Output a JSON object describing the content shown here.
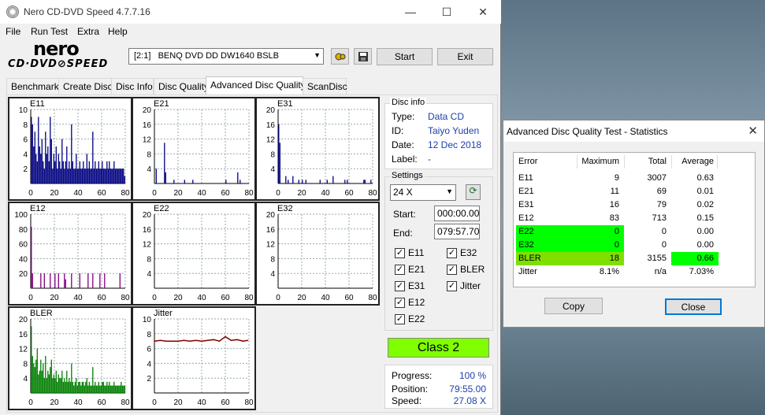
{
  "app": {
    "title": "Nero CD-DVD Speed 4.7.7.16"
  },
  "menu": [
    "File",
    "Run Test",
    "Extra",
    "Help"
  ],
  "logo": {
    "line1": "nero",
    "line2": "CD·DVD⊘SPEED"
  },
  "toolbar": {
    "drive": "[2:1]   BENQ DVD DD DW1640 BSLB",
    "start_label": "Start",
    "exit_label": "Exit"
  },
  "tabs": [
    "Benchmark",
    "Create Disc",
    "Disc Info",
    "Disc Quality",
    "Advanced Disc Quality",
    "ScanDisc"
  ],
  "active_tab": "Advanced Disc Quality",
  "disc_info": {
    "title": "Disc info",
    "type_label": "Type:",
    "type": "Data CD",
    "id_label": "ID:",
    "id": "Taiyo Yuden",
    "date_label": "Date:",
    "date": "12 Dec 2018",
    "label_label": "Label:",
    "label": "-"
  },
  "settings": {
    "title": "Settings",
    "speed": "24 X",
    "start_label": "Start:",
    "start": "000:00.00",
    "end_label": "End:",
    "end": "079:57.70",
    "checks": {
      "e11": "E11",
      "e21": "E21",
      "e31": "E31",
      "e12": "E12",
      "e22": "E22",
      "e32": "E32",
      "bler": "BLER",
      "jitter": "Jitter"
    }
  },
  "class_label": "Class 2",
  "progress": {
    "progress_label": "Progress:",
    "progress": "100 %",
    "position_label": "Position:",
    "position": "79:55.00",
    "speed_label": "Speed:",
    "speed": "27.08 X"
  },
  "stats_dialog": {
    "title": "Advanced Disc Quality Test - Statistics",
    "headers": [
      "Error",
      "Maximum",
      "Total",
      "Average"
    ],
    "rows": [
      [
        "E11",
        "9",
        "3007",
        "0.63"
      ],
      [
        "E21",
        "11",
        "69",
        "0.01"
      ],
      [
        "E31",
        "16",
        "79",
        "0.02"
      ],
      [
        "E12",
        "83",
        "713",
        "0.15"
      ],
      [
        "E22",
        "0",
        "0",
        "0.00"
      ],
      [
        "E32",
        "0",
        "0",
        "0.00"
      ],
      [
        "BLER",
        "18",
        "3155",
        "0.66"
      ],
      [
        "Jitter",
        "8.1%",
        "n/a",
        "7.03%"
      ]
    ],
    "copy_label": "Copy",
    "close_label": "Close"
  },
  "colors": {
    "e11": "#00007f",
    "e21": "#00007f",
    "e31": "#00007f",
    "e12": "#7f007f",
    "bler": "#007f00",
    "jitter": "#7f0000",
    "class_bg": "#80ff00"
  },
  "chart_data": [
    {
      "type": "bar",
      "title": "E11",
      "xlim": [
        0,
        80
      ],
      "ylim": [
        0,
        10
      ],
      "yticks": [
        2,
        4,
        6,
        8,
        10
      ],
      "xticks": [
        0,
        20,
        40,
        60,
        80
      ],
      "x": [
        0,
        1,
        2,
        3,
        4,
        5,
        6,
        7,
        8,
        9,
        10,
        11,
        12,
        13,
        14,
        15,
        16,
        17,
        18,
        19,
        20,
        21,
        22,
        23,
        24,
        25,
        26,
        27,
        28,
        29,
        30,
        31,
        32,
        33,
        34,
        35,
        36,
        37,
        38,
        39,
        40,
        41,
        42,
        43,
        44,
        45,
        46,
        47,
        48,
        49,
        50,
        51,
        52,
        53,
        54,
        55,
        56,
        57,
        58,
        59,
        60,
        61,
        62,
        63,
        64,
        65,
        66,
        67,
        68,
        69,
        70,
        71,
        72,
        73,
        74,
        75,
        76,
        77,
        78,
        79
      ],
      "values": [
        9,
        8,
        5,
        7,
        4,
        3,
        9,
        5,
        4,
        6,
        3,
        2,
        7,
        4,
        5,
        3,
        9,
        6,
        2,
        4,
        3,
        5,
        2,
        4,
        3,
        2,
        6,
        3,
        2,
        3,
        5,
        2,
        3,
        2,
        8,
        3,
        2,
        2,
        4,
        2,
        2,
        3,
        2,
        2,
        3,
        2,
        2,
        4,
        2,
        3,
        2,
        2,
        7,
        2,
        3,
        2,
        2,
        3,
        2,
        2,
        3,
        2,
        2,
        2,
        3,
        2,
        3,
        2,
        2,
        2,
        3,
        2,
        2,
        2,
        2,
        2,
        2,
        2,
        2,
        1
      ]
    },
    {
      "type": "bar",
      "title": "E21",
      "xlim": [
        0,
        80
      ],
      "ylim": [
        0,
        20
      ],
      "yticks": [
        4,
        8,
        12,
        16,
        20
      ],
      "xticks": [
        0,
        20,
        40,
        60,
        80
      ],
      "x": [
        1,
        8,
        9,
        16,
        25,
        32,
        60,
        70,
        72
      ],
      "values": [
        4,
        11,
        3,
        1,
        1,
        1,
        1,
        3,
        1
      ]
    },
    {
      "type": "bar",
      "title": "E31",
      "xlim": [
        0,
        80
      ],
      "ylim": [
        0,
        20
      ],
      "yticks": [
        4,
        8,
        12,
        16,
        20
      ],
      "xticks": [
        0,
        20,
        40,
        60,
        80
      ],
      "x": [
        0,
        1,
        6,
        8,
        12,
        17,
        20,
        23,
        35,
        41,
        46,
        56,
        58,
        72,
        73,
        78
      ],
      "values": [
        16,
        11,
        2,
        1,
        2,
        1,
        1,
        1,
        1,
        1,
        2,
        1,
        1,
        1,
        1,
        1
      ]
    },
    {
      "type": "bar",
      "title": "E12",
      "xlim": [
        0,
        80
      ],
      "ylim": [
        0,
        100
      ],
      "yticks": [
        20,
        40,
        60,
        80,
        100
      ],
      "xticks": [
        0,
        20,
        40,
        60,
        80
      ],
      "x": [
        0,
        1,
        8,
        11,
        16,
        20,
        23,
        28,
        29,
        34,
        41,
        48,
        52,
        58,
        62,
        75
      ],
      "values": [
        83,
        20,
        20,
        20,
        20,
        20,
        20,
        20,
        12,
        20,
        20,
        20,
        20,
        20,
        20,
        20
      ]
    },
    {
      "type": "bar",
      "title": "E22",
      "xlim": [
        0,
        80
      ],
      "ylim": [
        0,
        20
      ],
      "yticks": [
        4,
        8,
        12,
        16,
        20
      ],
      "xticks": [
        0,
        20,
        40,
        60,
        80
      ],
      "x": [],
      "values": []
    },
    {
      "type": "bar",
      "title": "E32",
      "xlim": [
        0,
        80
      ],
      "ylim": [
        0,
        20
      ],
      "yticks": [
        4,
        8,
        12,
        16,
        20
      ],
      "xticks": [
        0,
        20,
        40,
        60,
        80
      ],
      "x": [],
      "values": []
    },
    {
      "type": "bar",
      "title": "BLER",
      "xlim": [
        0,
        80
      ],
      "ylim": [
        0,
        20
      ],
      "yticks": [
        4,
        8,
        12,
        16,
        20
      ],
      "xticks": [
        0,
        20,
        40,
        60,
        80
      ],
      "x": [
        0,
        1,
        2,
        3,
        4,
        5,
        6,
        7,
        8,
        9,
        10,
        11,
        12,
        13,
        14,
        15,
        16,
        17,
        18,
        19,
        20,
        21,
        22,
        23,
        24,
        25,
        26,
        27,
        28,
        29,
        30,
        31,
        32,
        33,
        34,
        35,
        36,
        37,
        38,
        39,
        40,
        41,
        42,
        43,
        44,
        45,
        46,
        47,
        48,
        49,
        50,
        51,
        52,
        53,
        54,
        55,
        56,
        57,
        58,
        59,
        60,
        61,
        62,
        63,
        64,
        65,
        66,
        67,
        68,
        69,
        70,
        71,
        72,
        73,
        74,
        75,
        76,
        77,
        78,
        79
      ],
      "values": [
        18,
        10,
        8,
        7,
        9,
        12,
        5,
        6,
        9,
        6,
        8,
        4,
        10,
        4,
        6,
        5,
        7,
        9,
        4,
        5,
        4,
        6,
        3,
        5,
        4,
        4,
        6,
        3,
        4,
        3,
        6,
        3,
        4,
        3,
        8,
        3,
        2,
        3,
        4,
        2,
        3,
        3,
        2,
        3,
        3,
        2,
        3,
        4,
        2,
        3,
        2,
        2,
        7,
        2,
        3,
        2,
        2,
        3,
        2,
        2,
        3,
        3,
        2,
        2,
        3,
        2,
        3,
        2,
        2,
        2,
        3,
        2,
        2,
        2,
        2,
        2,
        3,
        2,
        2,
        2
      ]
    },
    {
      "type": "line",
      "title": "Jitter",
      "xlim": [
        0,
        80
      ],
      "ylim": [
        0,
        10
      ],
      "yticks": [
        2,
        4,
        6,
        8,
        10
      ],
      "xticks": [
        0,
        20,
        40,
        60,
        80
      ],
      "x": [
        0,
        5,
        10,
        15,
        20,
        25,
        30,
        35,
        40,
        45,
        50,
        55,
        60,
        65,
        70,
        75,
        79
      ],
      "values": [
        7.0,
        7.1,
        7.0,
        7.0,
        7.0,
        7.1,
        7.0,
        7.1,
        7.0,
        7.1,
        7.2,
        7.0,
        7.6,
        7.1,
        7.2,
        7.0,
        7.1
      ]
    }
  ]
}
